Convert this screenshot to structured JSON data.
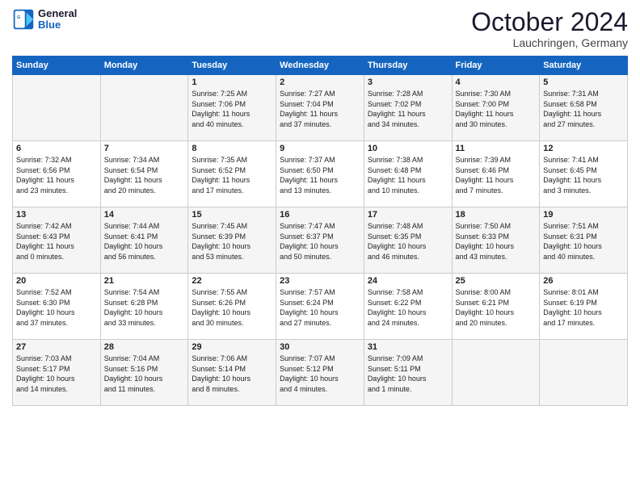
{
  "header": {
    "logo_general": "General",
    "logo_blue": "Blue",
    "month": "October 2024",
    "location": "Lauchringen, Germany"
  },
  "days_of_week": [
    "Sunday",
    "Monday",
    "Tuesday",
    "Wednesday",
    "Thursday",
    "Friday",
    "Saturday"
  ],
  "rows": [
    [
      {
        "day": "",
        "info": ""
      },
      {
        "day": "",
        "info": ""
      },
      {
        "day": "1",
        "info": "Sunrise: 7:25 AM\nSunset: 7:06 PM\nDaylight: 11 hours\nand 40 minutes."
      },
      {
        "day": "2",
        "info": "Sunrise: 7:27 AM\nSunset: 7:04 PM\nDaylight: 11 hours\nand 37 minutes."
      },
      {
        "day": "3",
        "info": "Sunrise: 7:28 AM\nSunset: 7:02 PM\nDaylight: 11 hours\nand 34 minutes."
      },
      {
        "day": "4",
        "info": "Sunrise: 7:30 AM\nSunset: 7:00 PM\nDaylight: 11 hours\nand 30 minutes."
      },
      {
        "day": "5",
        "info": "Sunrise: 7:31 AM\nSunset: 6:58 PM\nDaylight: 11 hours\nand 27 minutes."
      }
    ],
    [
      {
        "day": "6",
        "info": "Sunrise: 7:32 AM\nSunset: 6:56 PM\nDaylight: 11 hours\nand 23 minutes."
      },
      {
        "day": "7",
        "info": "Sunrise: 7:34 AM\nSunset: 6:54 PM\nDaylight: 11 hours\nand 20 minutes."
      },
      {
        "day": "8",
        "info": "Sunrise: 7:35 AM\nSunset: 6:52 PM\nDaylight: 11 hours\nand 17 minutes."
      },
      {
        "day": "9",
        "info": "Sunrise: 7:37 AM\nSunset: 6:50 PM\nDaylight: 11 hours\nand 13 minutes."
      },
      {
        "day": "10",
        "info": "Sunrise: 7:38 AM\nSunset: 6:48 PM\nDaylight: 11 hours\nand 10 minutes."
      },
      {
        "day": "11",
        "info": "Sunrise: 7:39 AM\nSunset: 6:46 PM\nDaylight: 11 hours\nand 7 minutes."
      },
      {
        "day": "12",
        "info": "Sunrise: 7:41 AM\nSunset: 6:45 PM\nDaylight: 11 hours\nand 3 minutes."
      }
    ],
    [
      {
        "day": "13",
        "info": "Sunrise: 7:42 AM\nSunset: 6:43 PM\nDaylight: 11 hours\nand 0 minutes."
      },
      {
        "day": "14",
        "info": "Sunrise: 7:44 AM\nSunset: 6:41 PM\nDaylight: 10 hours\nand 56 minutes."
      },
      {
        "day": "15",
        "info": "Sunrise: 7:45 AM\nSunset: 6:39 PM\nDaylight: 10 hours\nand 53 minutes."
      },
      {
        "day": "16",
        "info": "Sunrise: 7:47 AM\nSunset: 6:37 PM\nDaylight: 10 hours\nand 50 minutes."
      },
      {
        "day": "17",
        "info": "Sunrise: 7:48 AM\nSunset: 6:35 PM\nDaylight: 10 hours\nand 46 minutes."
      },
      {
        "day": "18",
        "info": "Sunrise: 7:50 AM\nSunset: 6:33 PM\nDaylight: 10 hours\nand 43 minutes."
      },
      {
        "day": "19",
        "info": "Sunrise: 7:51 AM\nSunset: 6:31 PM\nDaylight: 10 hours\nand 40 minutes."
      }
    ],
    [
      {
        "day": "20",
        "info": "Sunrise: 7:52 AM\nSunset: 6:30 PM\nDaylight: 10 hours\nand 37 minutes."
      },
      {
        "day": "21",
        "info": "Sunrise: 7:54 AM\nSunset: 6:28 PM\nDaylight: 10 hours\nand 33 minutes."
      },
      {
        "day": "22",
        "info": "Sunrise: 7:55 AM\nSunset: 6:26 PM\nDaylight: 10 hours\nand 30 minutes."
      },
      {
        "day": "23",
        "info": "Sunrise: 7:57 AM\nSunset: 6:24 PM\nDaylight: 10 hours\nand 27 minutes."
      },
      {
        "day": "24",
        "info": "Sunrise: 7:58 AM\nSunset: 6:22 PM\nDaylight: 10 hours\nand 24 minutes."
      },
      {
        "day": "25",
        "info": "Sunrise: 8:00 AM\nSunset: 6:21 PM\nDaylight: 10 hours\nand 20 minutes."
      },
      {
        "day": "26",
        "info": "Sunrise: 8:01 AM\nSunset: 6:19 PM\nDaylight: 10 hours\nand 17 minutes."
      }
    ],
    [
      {
        "day": "27",
        "info": "Sunrise: 7:03 AM\nSunset: 5:17 PM\nDaylight: 10 hours\nand 14 minutes."
      },
      {
        "day": "28",
        "info": "Sunrise: 7:04 AM\nSunset: 5:16 PM\nDaylight: 10 hours\nand 11 minutes."
      },
      {
        "day": "29",
        "info": "Sunrise: 7:06 AM\nSunset: 5:14 PM\nDaylight: 10 hours\nand 8 minutes."
      },
      {
        "day": "30",
        "info": "Sunrise: 7:07 AM\nSunset: 5:12 PM\nDaylight: 10 hours\nand 4 minutes."
      },
      {
        "day": "31",
        "info": "Sunrise: 7:09 AM\nSunset: 5:11 PM\nDaylight: 10 hours\nand 1 minute."
      },
      {
        "day": "",
        "info": ""
      },
      {
        "day": "",
        "info": ""
      }
    ]
  ]
}
